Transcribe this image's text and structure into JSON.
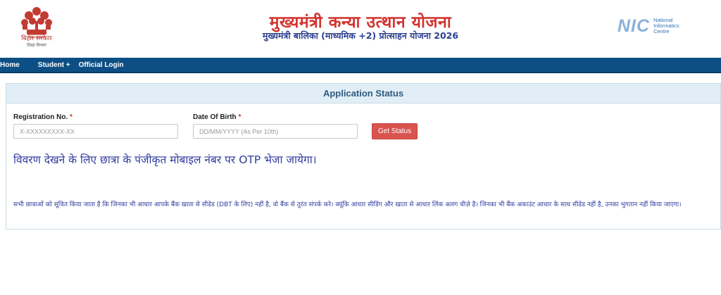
{
  "header": {
    "emblem_caption": "बिहार सरकार",
    "emblem_subcaption": "शिक्षा विभाग",
    "title": "मुख्यमंत्री कन्या उत्थान योजना",
    "subtitle": "मुख्यमंत्री बालिका (माध्यमिक +2) प्रोत्साहन योजना 2026",
    "nic_word": "NIC",
    "nic_line1": "National",
    "nic_line2": "Informatics",
    "nic_line3": "Centre"
  },
  "nav": {
    "items": [
      "Home",
      "Student +",
      "Official Login"
    ]
  },
  "panel": {
    "title": "Application Status",
    "registration_label": "Registration No.",
    "registration_placeholder": "X-XXXXXXXXX-XX",
    "dob_label": "Date Of Birth",
    "dob_placeholder": "DD/MM/YYYY (As Per 10th)",
    "required_mark": "*",
    "get_status_label": "Get Status",
    "otp_message": "विवरण देखने के लिए छात्रा के पंजीकृत मोबाइल नंबर पर OTP भेजा जायेगा।",
    "notice": "सभी छात्राओं को सूचित किया जाता है कि जिनका भी आधार आपके बैंक खाता से सीडेड (DBT के लिए) नहीं है, वो बैंक से तुरंत संपर्क करे। क्यूंकि आधार सीडिंग और खाता से आधार लिंक अलग चीज़े है। जिनका भी बैंक अकाउंट आधार के साथ सीडेड नहीं है, उनका भुगतान नहीं किया जाएगा।"
  },
  "colors": {
    "title_red": "#d2342f",
    "subtitle_blue": "#2b3f8f",
    "navbar": "#0d4f84",
    "button_red": "#d9534f",
    "panel_head": "#e1eef6",
    "text_blue": "#2e3b9e"
  }
}
